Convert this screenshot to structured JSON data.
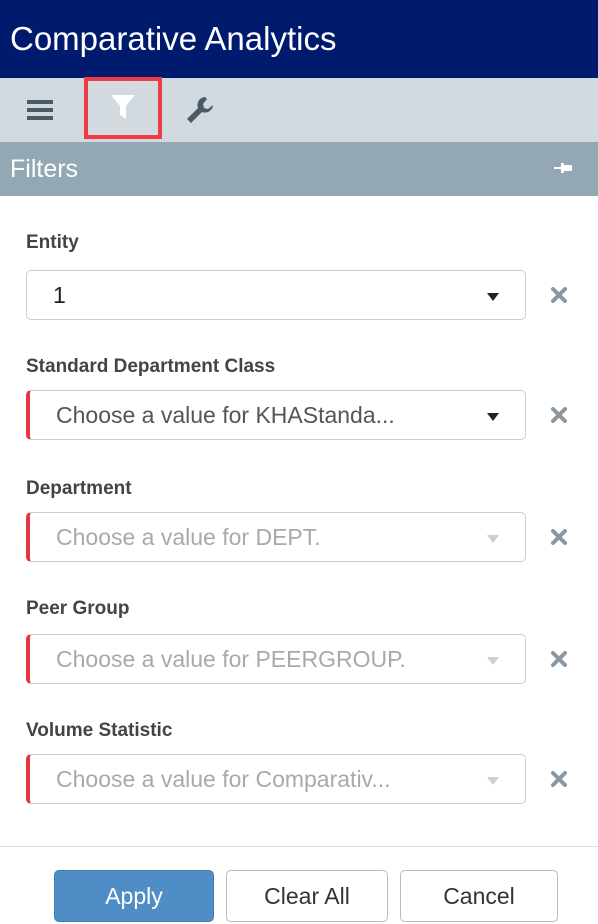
{
  "app": {
    "title": "Comparative Analytics"
  },
  "toolbar": {
    "items": [
      {
        "icon": "hamburger-menu-icon"
      },
      {
        "icon": "filter-icon",
        "selected": true
      },
      {
        "icon": "wrench-icon"
      }
    ]
  },
  "panel": {
    "title": "Filters",
    "pin_icon": "pin-icon"
  },
  "filters": [
    {
      "label": "Entity",
      "value": "1",
      "placeholder": "",
      "required": false,
      "disabled": false
    },
    {
      "label": "Standard Department Class",
      "value": "",
      "placeholder": "Choose a value for KHAStanda...",
      "required": true,
      "disabled": false
    },
    {
      "label": "Department",
      "value": "",
      "placeholder": "Choose a value for DEPT.",
      "required": true,
      "disabled": true
    },
    {
      "label": "Peer Group",
      "value": "",
      "placeholder": "Choose a value for PEERGROUP.",
      "required": true,
      "disabled": true
    },
    {
      "label": "Volume Statistic",
      "value": "",
      "placeholder": "Choose a value for Comparativ...",
      "required": true,
      "disabled": true
    }
  ],
  "buttons": {
    "apply": "Apply",
    "clear_all": "Clear All",
    "cancel": "Cancel"
  },
  "colors": {
    "title_bar": "#001a6e",
    "toolbar": "#d2dadf",
    "panel_header": "#93a8b3",
    "selected_outline": "#ee3b45",
    "required_marker": "#e2373f",
    "primary_button": "#4f8dc6"
  }
}
